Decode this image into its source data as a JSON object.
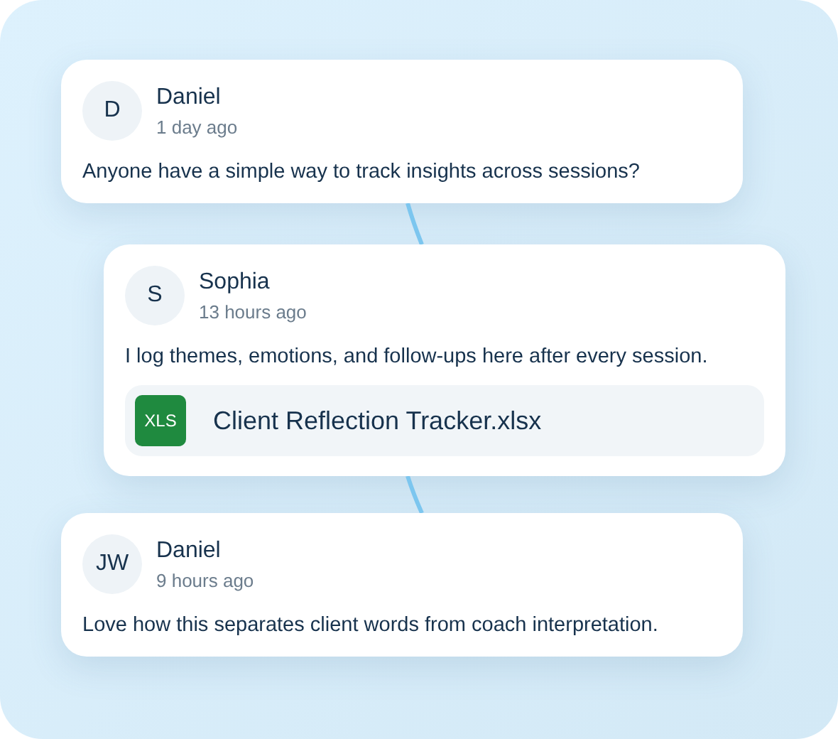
{
  "posts": [
    {
      "avatar": "D",
      "author": "Daniel",
      "time": "1 day ago",
      "text": "Anyone have a simple way to track insights across sessions?",
      "indented": false
    },
    {
      "avatar": "S",
      "author": "Sophia",
      "time": "13 hours ago",
      "text": "I log themes, emotions, and follow-ups here after every session.",
      "indented": true,
      "attachment": {
        "badge": "XLS",
        "filename": "Client Reflection Tracker.xlsx"
      }
    },
    {
      "avatar": "JW",
      "author": "Daniel",
      "time": "9 hours ago",
      "text": "Love how this separates client words from coach interpretation.",
      "indented": false
    }
  ]
}
